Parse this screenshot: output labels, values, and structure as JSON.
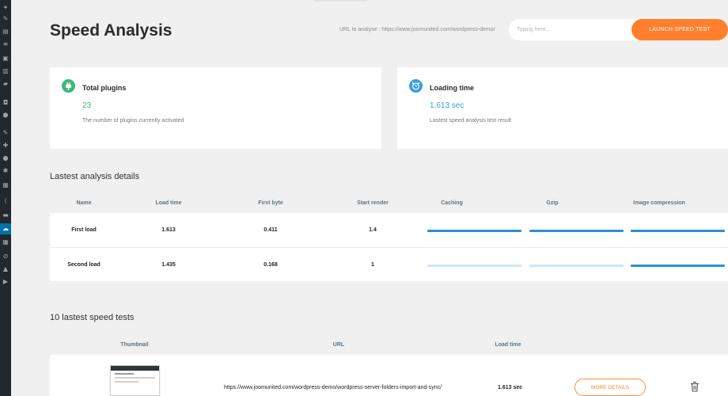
{
  "page": {
    "title": "Speed Analysis",
    "url_label": "URL to analyse : https://www.joomunited.com/wordpress-demo/",
    "input_placeholder": "Typing here...",
    "launch_button": "LAUNCH SPEED TEST"
  },
  "cards": {
    "plugins": {
      "title": "Total plugins",
      "value": "23",
      "subtitle": "The number of plugins currently activated",
      "icon": "plug-icon"
    },
    "loading": {
      "title": "Loading time",
      "value": "1.613 sec",
      "subtitle": "Lastest speed analysis test result",
      "icon": "alarm-clock-icon"
    }
  },
  "analysis": {
    "title": "Lastest analysis details",
    "headers": {
      "name": "Name",
      "load": "Load time",
      "first_byte": "First byte",
      "start_render": "Start render",
      "caching": "Caching",
      "gzip": "Gzip",
      "image_compression": "Image compression"
    },
    "rows": [
      {
        "name": "First load",
        "load": "1.613",
        "first_byte": "0.411",
        "start_render": "1.4",
        "caching": 1,
        "gzip": 1,
        "image_compression": 1
      },
      {
        "name": "Second load",
        "load": "1.435",
        "first_byte": "0.168",
        "start_render": "1",
        "caching": 0,
        "gzip": 0,
        "image_compression": 1
      }
    ]
  },
  "tests": {
    "title": "10 lastest speed tests",
    "headers": {
      "thumbnail": "Thumbnail",
      "url": "URL",
      "load": "Load time"
    },
    "rows": [
      {
        "url": "https://www.joomunited.com/wordpress-demo/wordpress-server-folders-import-and-sync/",
        "load": "1.613 sec",
        "details": "MORE DETAILS"
      }
    ]
  },
  "colors": {
    "accent": "#ff7f2d",
    "bar_active": "#2a8fdc",
    "bar_inactive": "#cfe5f5",
    "plugin_green": "#3cb878",
    "loading_blue": "#3a9ee4",
    "sidebar": "#23282d",
    "sidebar_active": "#0073aa"
  }
}
